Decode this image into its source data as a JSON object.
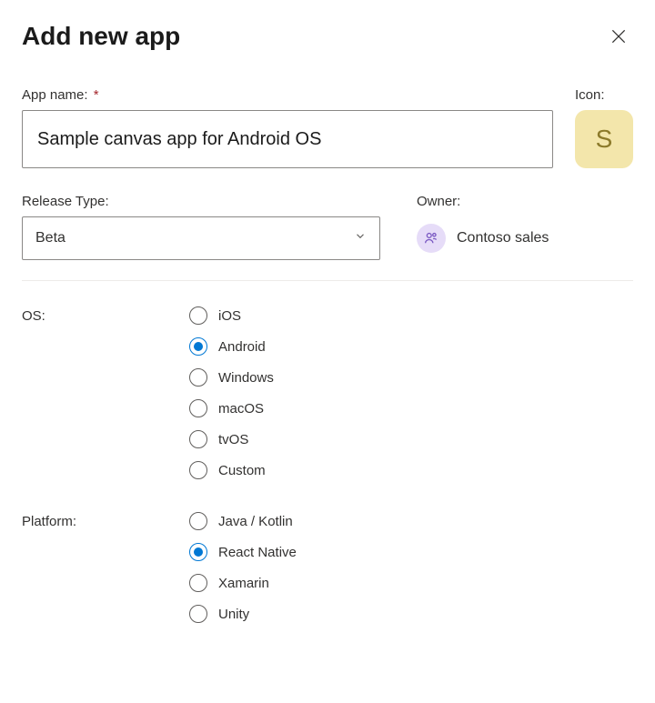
{
  "dialog": {
    "title": "Add new app"
  },
  "appName": {
    "label": "App name:",
    "required": "*",
    "value": "Sample canvas app for Android OS"
  },
  "icon": {
    "label": "Icon:",
    "letter": "S"
  },
  "releaseType": {
    "label": "Release Type:",
    "value": "Beta"
  },
  "owner": {
    "label": "Owner:",
    "value": "Contoso sales"
  },
  "os": {
    "label": "OS:",
    "selected": "Android",
    "options": [
      "iOS",
      "Android",
      "Windows",
      "macOS",
      "tvOS",
      "Custom"
    ]
  },
  "platform": {
    "label": "Platform:",
    "selected": "React Native",
    "options": [
      "Java / Kotlin",
      "React Native",
      "Xamarin",
      "Unity"
    ]
  }
}
